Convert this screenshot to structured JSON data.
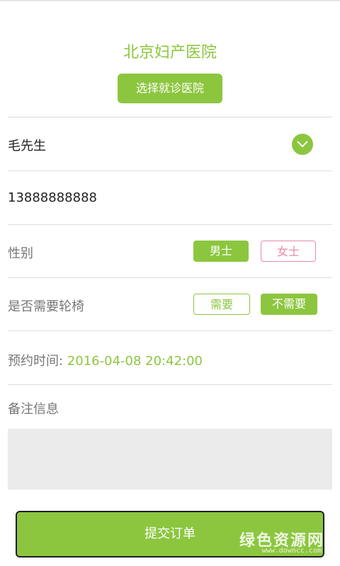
{
  "hospital": {
    "name": "北京妇产医院",
    "select_label": "选择就诊医院"
  },
  "patient": {
    "name": "毛先生",
    "phone": "13888888888"
  },
  "gender": {
    "label": "性别",
    "options": [
      "男士",
      "女士"
    ],
    "selected": "男士"
  },
  "wheelchair": {
    "label": "是否需要轮椅",
    "options": [
      "需要",
      "不需要"
    ],
    "selected": "不需要"
  },
  "appointment": {
    "label": "预约时间:",
    "value": "2016-04-08 20:42:00"
  },
  "notes": {
    "label": "备注信息",
    "value": ""
  },
  "submit_label": "提交订单",
  "watermark": {
    "text": "绿色资源网",
    "sub": "www.downcc.com"
  },
  "colors": {
    "accent": "#8cc63f",
    "pink": "#e88aa2",
    "divider": "#dcdcdc"
  }
}
